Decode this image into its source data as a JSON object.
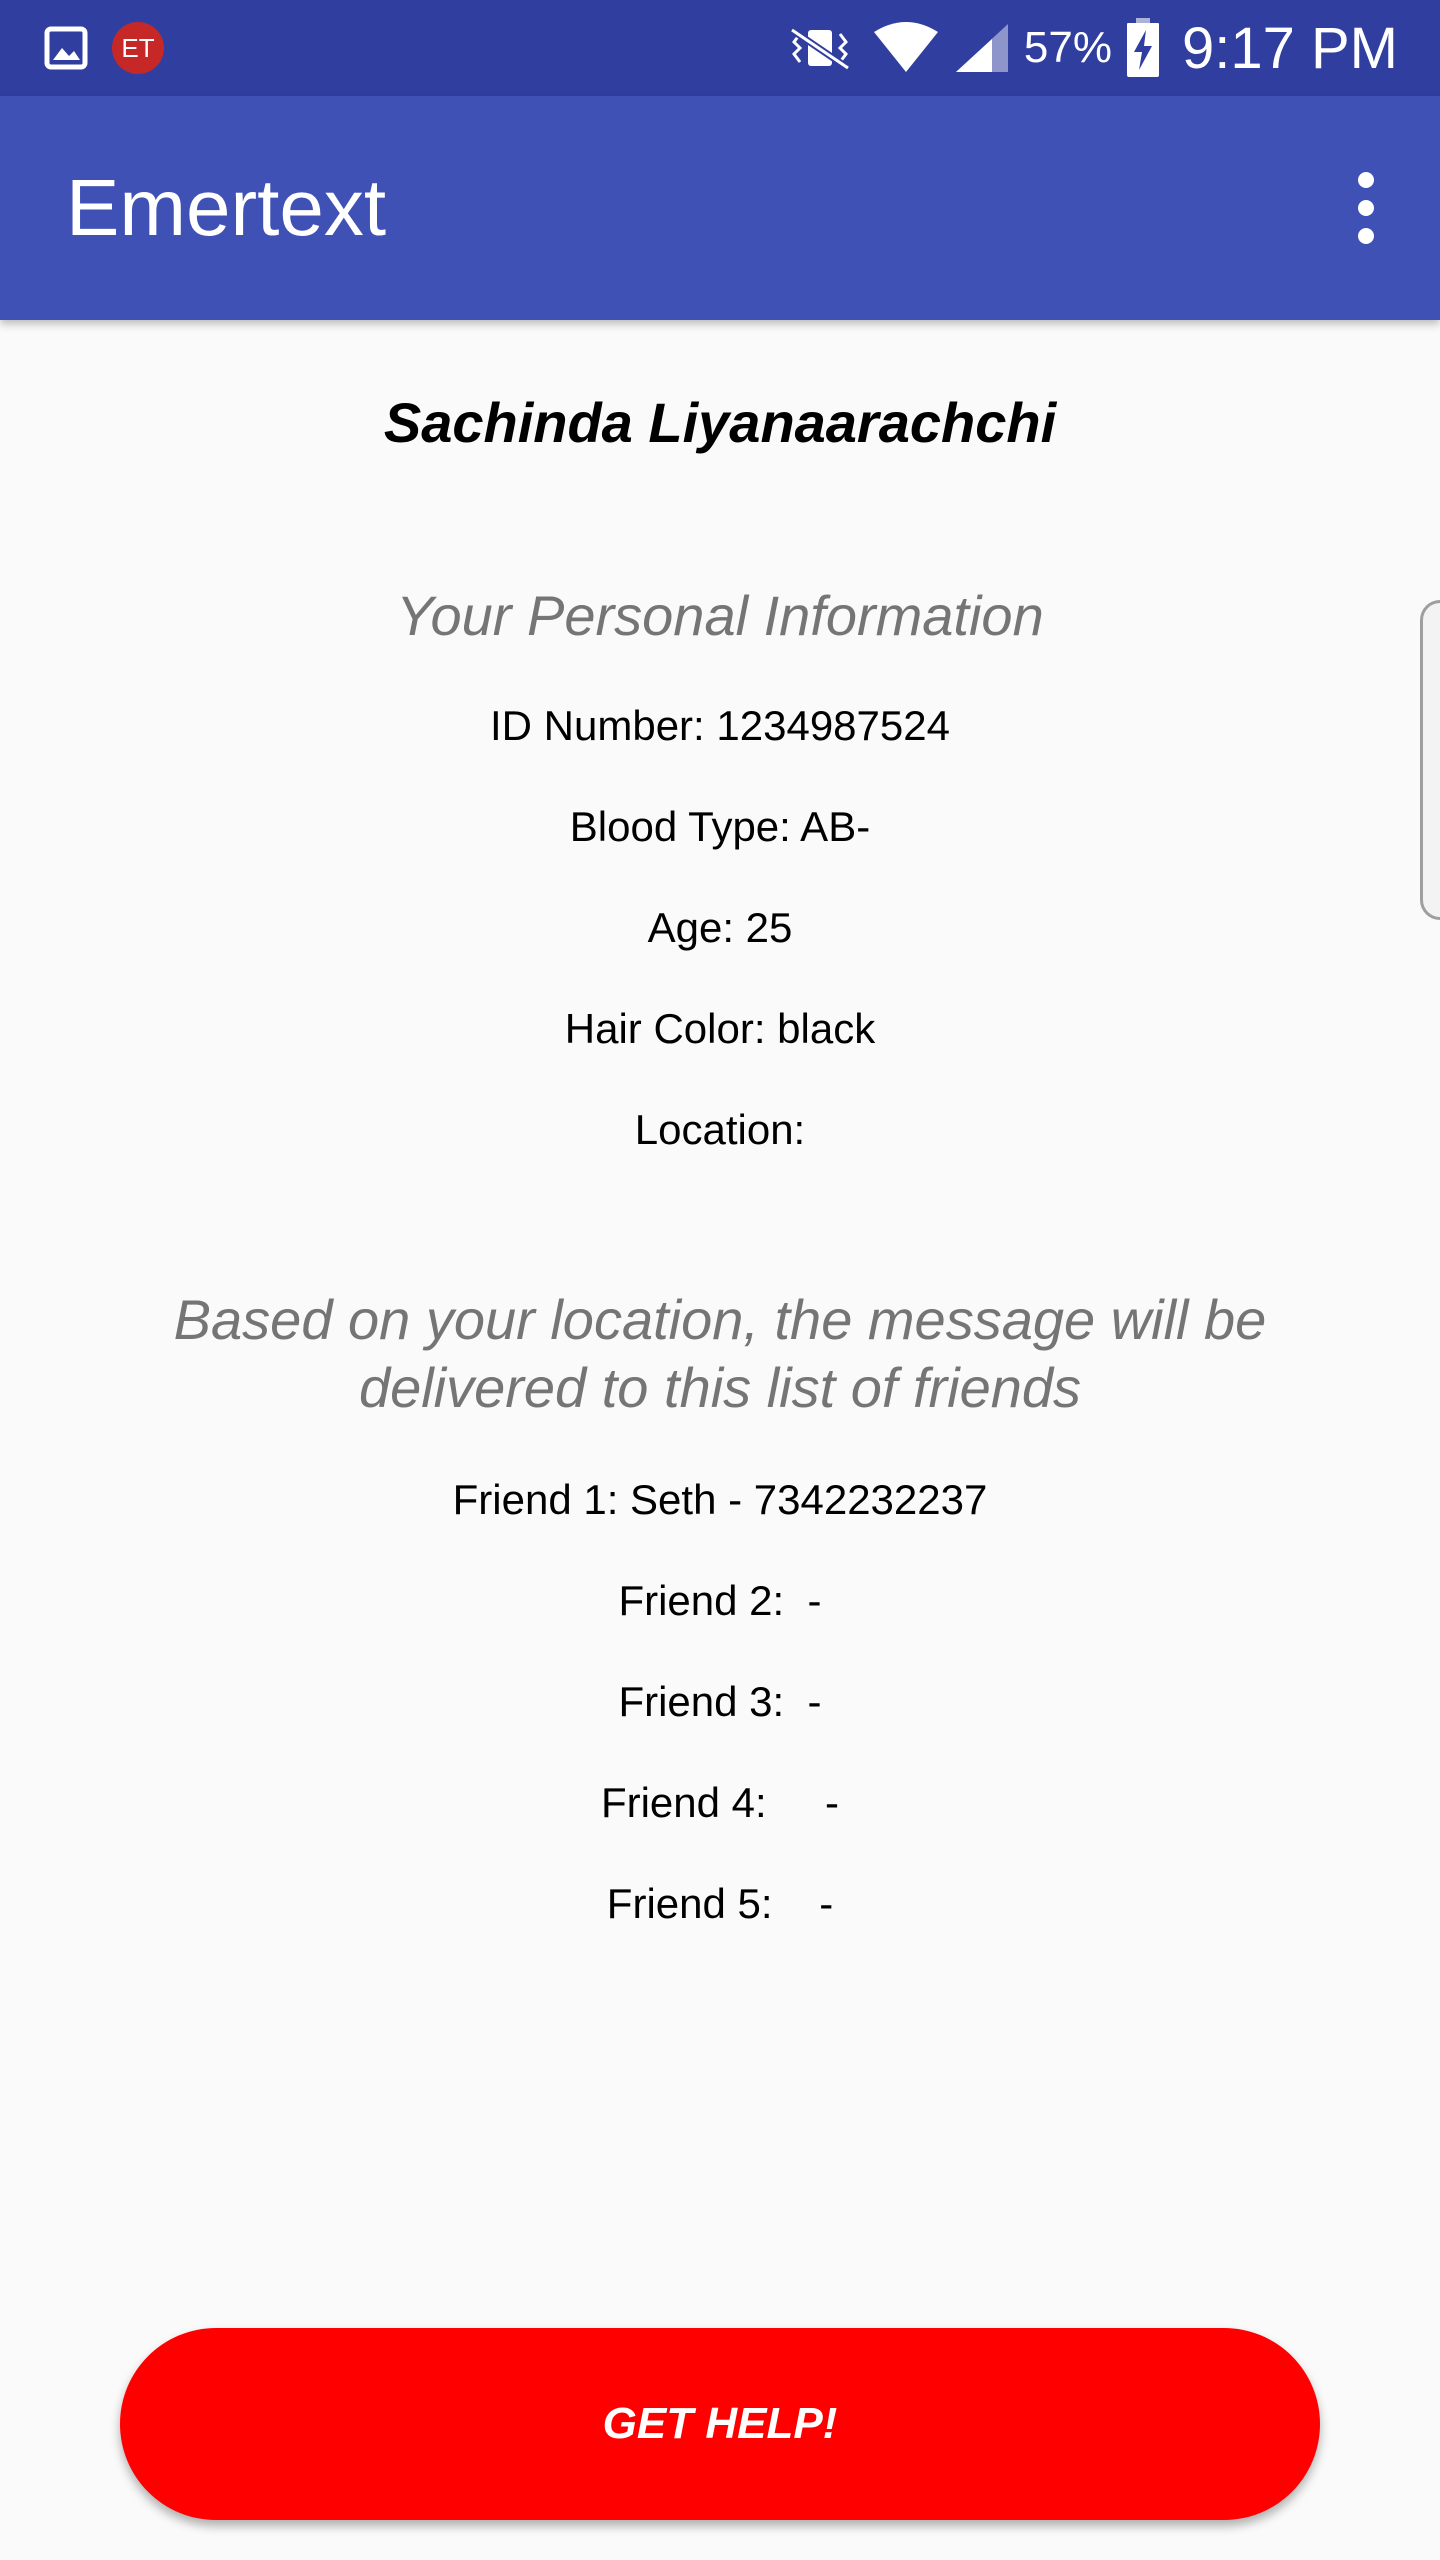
{
  "status_bar": {
    "battery_text": "57%",
    "time": "9:17 PM",
    "notification_badge": "ET",
    "icons": [
      "gallery-icon",
      "emertext-notification-icon",
      "vibrate-icon",
      "wifi-icon",
      "signal-icon",
      "battery-charging-icon"
    ]
  },
  "app_bar": {
    "title": "Emertext",
    "menu_icon": "overflow-menu-icon"
  },
  "profile": {
    "name": "Sachinda Liyanaarachchi"
  },
  "personal_info": {
    "heading": "Your Personal Information",
    "id_number": "ID Number: 1234987524",
    "blood_type": "Blood Type: AB-",
    "age": "Age: 25",
    "hair_color": "Hair Color: black",
    "location": "Location:"
  },
  "friends": {
    "heading_line1": "Based on your location, the message will be",
    "heading_line2": "delivered to this list of friends",
    "items": [
      "Friend 1: Seth - 7342232237",
      "Friend 2:  -",
      "Friend 3:  -",
      "Friend 4:     -",
      "Friend 5:    -"
    ]
  },
  "actions": {
    "help_button": "GET HELP!"
  },
  "colors": {
    "status_bar": "#303f9f",
    "app_bar": "#3f51b5",
    "help_button": "#ff0000",
    "background": "#fafafa"
  }
}
